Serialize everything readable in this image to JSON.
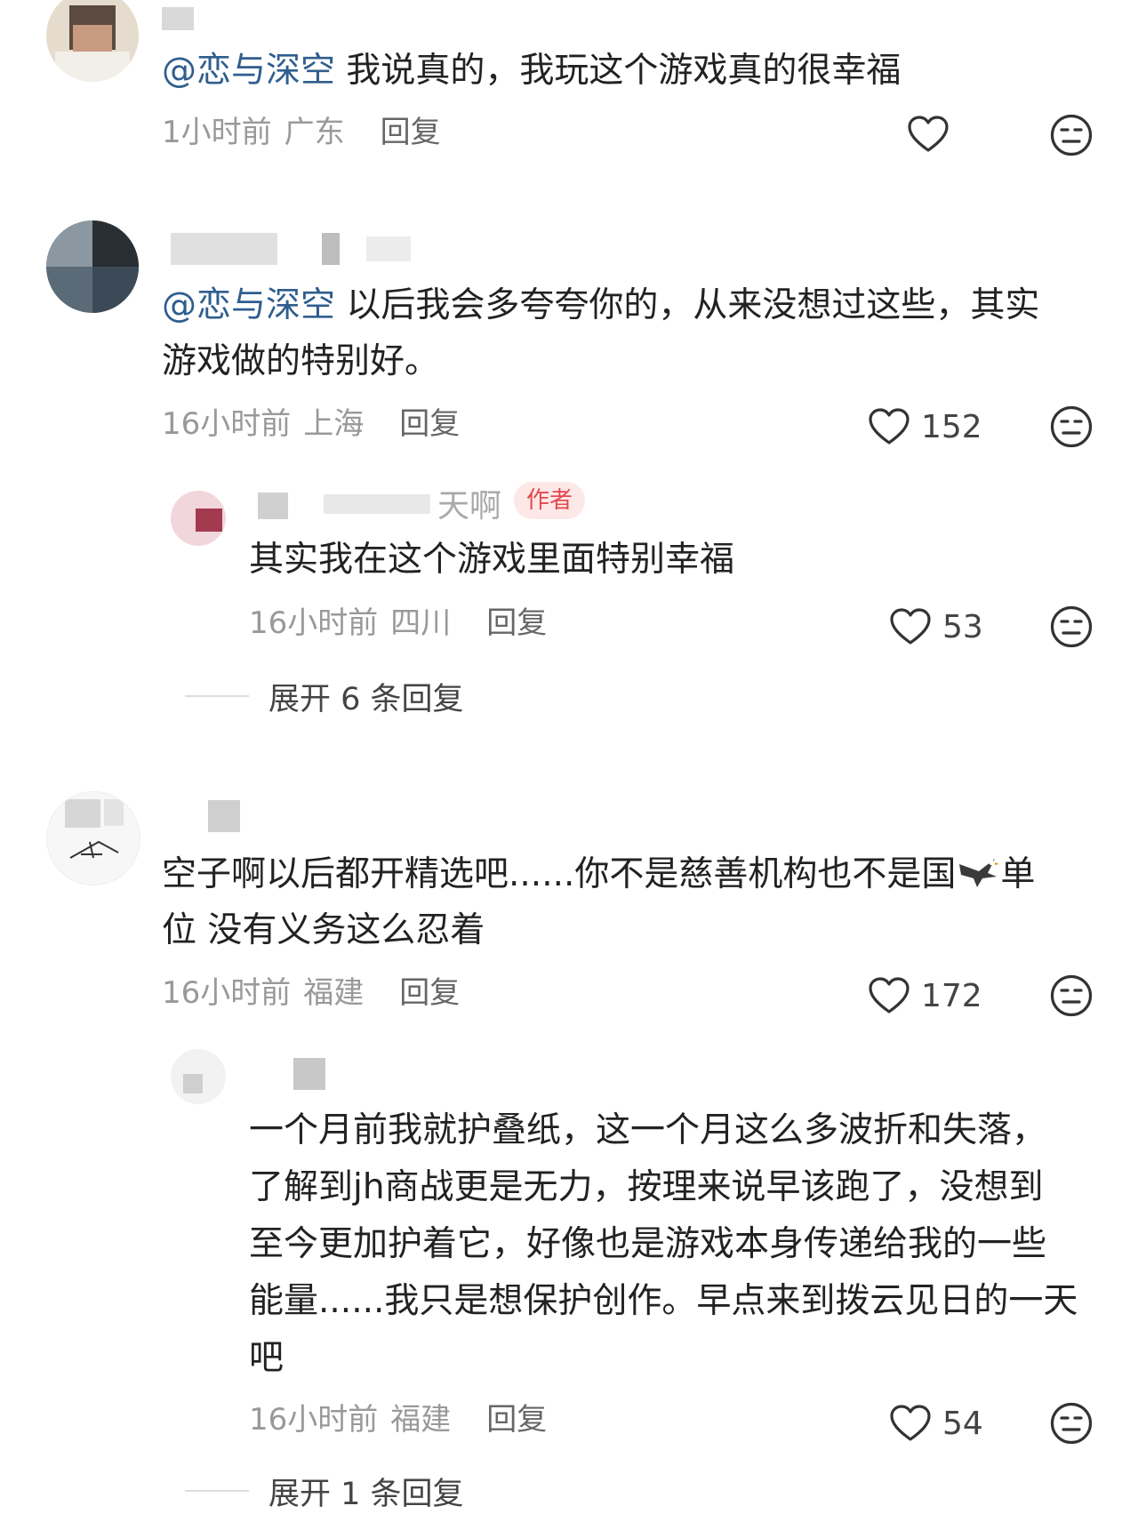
{
  "colors": {
    "mention": "#2f5e8e",
    "meta": "#999999",
    "badge_bg": "#fde8e8",
    "badge_text": "#e5484d"
  },
  "comments": [
    {
      "mention": "@恋与深空",
      "text": " 我说真的，我玩这个游戏真的很幸福",
      "time": "1小时前",
      "location": "广东",
      "reply_label": "回复",
      "likes": "",
      "like_icon": "heart-outline-icon",
      "dislike_icon": "unhappy-face-icon"
    },
    {
      "mention": "@恋与深空",
      "text_line1": " 以后我会多夸夸你的，从来没想过这些，其实",
      "text_line2": "游戏做的特别好。",
      "time": "16小时前",
      "location": "上海",
      "reply_label": "回复",
      "likes": "152",
      "reply": {
        "name_tail": "天啊",
        "badge": "作者",
        "text": "其实我在这个游戏里面特别幸福",
        "time": "16小时前",
        "location": "四川",
        "reply_label": "回复",
        "likes": "53"
      },
      "expand_label": "展开 6 条回复"
    },
    {
      "text_line1a": "空子啊以后都开精选吧......你不是慈善机构也不是国",
      "text_line1b": "单",
      "text_line2": "位 没有义务这么忍着",
      "emoji": "eagle-emoji",
      "time": "16小时前",
      "location": "福建",
      "reply_label": "回复",
      "likes": "172",
      "reply": {
        "lines": [
          "一个月前我就护叠纸，这一个月这么多波折和失落，",
          "了解到jh商战更是无力，按理来说早该跑了，没想到",
          "至今更加护着它，好像也是游戏本身传递给我的一些",
          "能量......我只是想保护创作。早点来到拨云见日的一天",
          "吧"
        ],
        "time": "16小时前",
        "location": "福建",
        "reply_label": "回复",
        "likes": "54"
      },
      "expand_label": "展开 1 条回复"
    }
  ]
}
